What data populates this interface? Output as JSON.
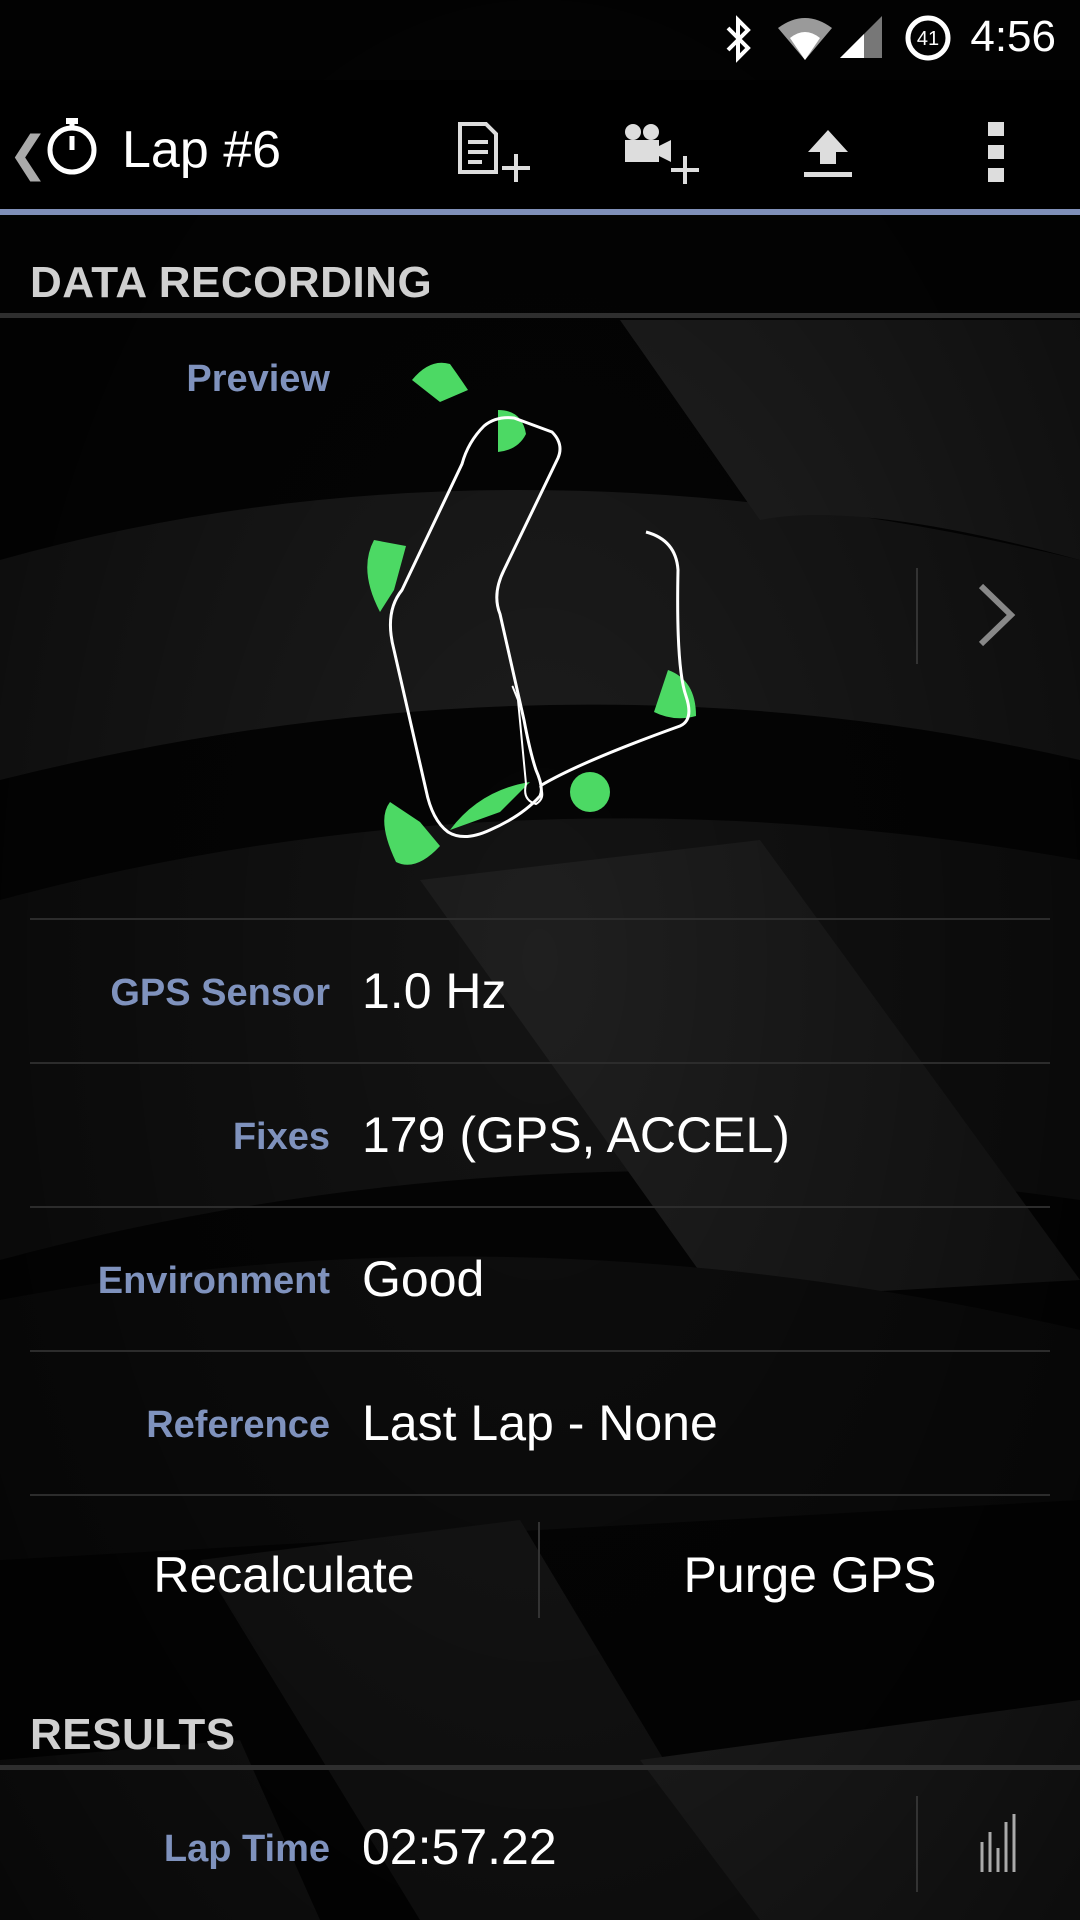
{
  "status_bar": {
    "time": "4:56",
    "badge": "41",
    "icons": [
      "bluetooth-icon",
      "wifi-icon",
      "cell-signal-icon",
      "data-saver-icon"
    ]
  },
  "action_bar": {
    "title": "Lap #6",
    "icons": [
      "back-caret-icon",
      "stopwatch-icon",
      "add-note-icon",
      "add-video-icon",
      "upload-icon",
      "overflow-menu-icon"
    ]
  },
  "colors": {
    "accent": "#7f8fb8",
    "label": "#7f92bd",
    "track_highlight": "#4cd964",
    "track_line": "#ffffff"
  },
  "data_recording": {
    "header": "DATA RECORDING",
    "preview_label": "Preview",
    "rows": [
      {
        "label": "GPS Sensor",
        "value": "1.0 Hz"
      },
      {
        "label": "Fixes",
        "value": "179 (GPS, ACCEL)"
      },
      {
        "label": "Environment",
        "value": "Good"
      },
      {
        "label": "Reference",
        "value": "Last Lap - None"
      }
    ],
    "buttons": {
      "recalculate": "Recalculate",
      "purge": "Purge GPS"
    }
  },
  "results": {
    "header": "RESULTS",
    "lap_time_label": "Lap Time",
    "lap_time_value": "02:57.22"
  }
}
